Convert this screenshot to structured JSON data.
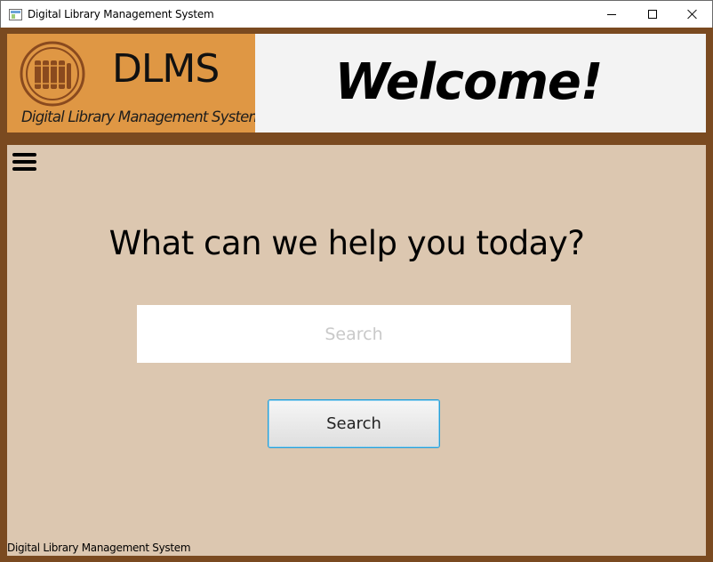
{
  "window": {
    "title": "Digital Library Management System",
    "icons": [
      "app-icon",
      "minimize-icon",
      "maximize-icon",
      "close-icon"
    ]
  },
  "header": {
    "logo_title": "DLMS",
    "logo_subtitle": "Digital Library Management System",
    "welcome": "Welcome!"
  },
  "main": {
    "menu_icon": "hamburger-menu-icon",
    "heading": "What can we help you today?",
    "search_placeholder": "Search",
    "search_value": "",
    "search_button_label": "Search"
  },
  "status": {
    "text": "Digital Library Management System"
  },
  "colors": {
    "frame_brown": "#7a4a20",
    "logo_orange": "#df9744",
    "content_tan": "#dcc7b0",
    "welcome_bg": "#f3f3f3",
    "focus_blue": "#2a9fd6"
  }
}
